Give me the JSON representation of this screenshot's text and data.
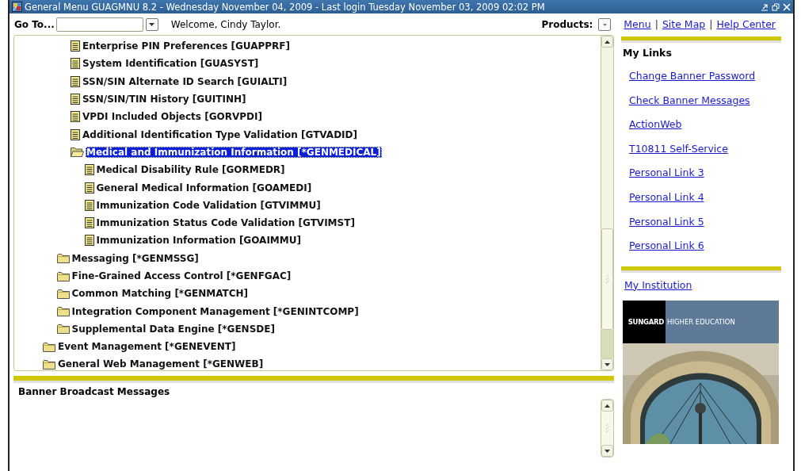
{
  "window": {
    "title": "General Menu  GUAGMNU  8.2 - Wednesday November 04, 2009 - Last login Tuesday November 03, 2009 02:02 PM"
  },
  "toolbar": {
    "goto_label": "Go To...",
    "welcome": "Welcome, Cindy Taylor.",
    "products_label": "Products:",
    "separator": "|",
    "links": [
      {
        "label": "Menu"
      },
      {
        "label": "Site Map"
      },
      {
        "label": "Help Center"
      }
    ]
  },
  "tree": [
    {
      "children": [
        {
          "children": [
            {
              "label": "Enterprise PIN Preferences [GUAPPRF]",
              "kind": "form",
              "selected": false
            },
            {
              "label": "System Identification [GUASYST]",
              "kind": "form",
              "selected": false
            },
            {
              "label": "SSN/SIN Alternate ID Search [GUIALTI]",
              "kind": "form",
              "selected": false
            },
            {
              "label": "SSN/SIN/TIN History [GUITINH]",
              "kind": "form",
              "selected": false
            },
            {
              "label": "VPDI Included Objects [GORVPDI]",
              "kind": "form",
              "selected": false
            },
            {
              "label": "Additional Identification Type Validation [GTVADID]",
              "kind": "form",
              "selected": false
            },
            {
              "label": "Medical and Immunization Information [*GENMEDICAL]",
              "kind": "folder",
              "expanded": true,
              "selected": true,
              "children": [
                {
                  "label": "Medical Disability Rule [GORMEDR]",
                  "kind": "form",
                  "selected": false
                },
                {
                  "label": "General Medical Information [GOAMEDI]",
                  "kind": "form",
                  "selected": false
                },
                {
                  "label": "Immunization Code Validation [GTVIMMU]",
                  "kind": "form",
                  "selected": false
                },
                {
                  "label": "Immunization Status Code Validation [GTVIMST]",
                  "kind": "form",
                  "selected": false
                },
                {
                  "label": "Immunization Information [GOAIMMU]",
                  "kind": "form",
                  "selected": false
                }
              ]
            }
          ]
        },
        {
          "label": "Messaging [*GENMSSG]",
          "kind": "folder",
          "expanded": false,
          "selected": false
        },
        {
          "label": "Fine-Grained Access Control [*GENFGAC]",
          "kind": "folder",
          "expanded": false,
          "selected": false
        },
        {
          "label": "Common Matching [*GENMATCH]",
          "kind": "folder",
          "expanded": false,
          "selected": false
        },
        {
          "label": "Integration Component Management [*GENINTCOMP]",
          "kind": "folder",
          "expanded": false,
          "selected": false
        },
        {
          "label": "Supplemental Data Engine [*GENSDE]",
          "kind": "folder",
          "expanded": false,
          "selected": false
        }
      ]
    },
    {
      "label": "Event Management [*GENEVENT]",
      "kind": "folder",
      "expanded": false,
      "selected": false
    },
    {
      "label": "General Web Management [*GENWEB]",
      "kind": "folder",
      "expanded": false,
      "selected": false
    }
  ],
  "broadcast": {
    "title": "Banner Broadcast Messages"
  },
  "sidebar": {
    "my_links_title": "My Links",
    "links": [
      {
        "label": "Change Banner Password"
      },
      {
        "label": "Check Banner Messages"
      },
      {
        "label": "ActionWeb"
      },
      {
        "label": "T10811 Self-Service"
      },
      {
        "label": "Personal Link 3"
      },
      {
        "label": "Personal Link 4"
      },
      {
        "label": "Personal Link 5"
      },
      {
        "label": "Personal Link 6"
      }
    ],
    "institution_link": "My Institution",
    "promo": {
      "brand": "SUNGARD",
      "tagline": "HIGHER EDUCATION"
    }
  }
}
